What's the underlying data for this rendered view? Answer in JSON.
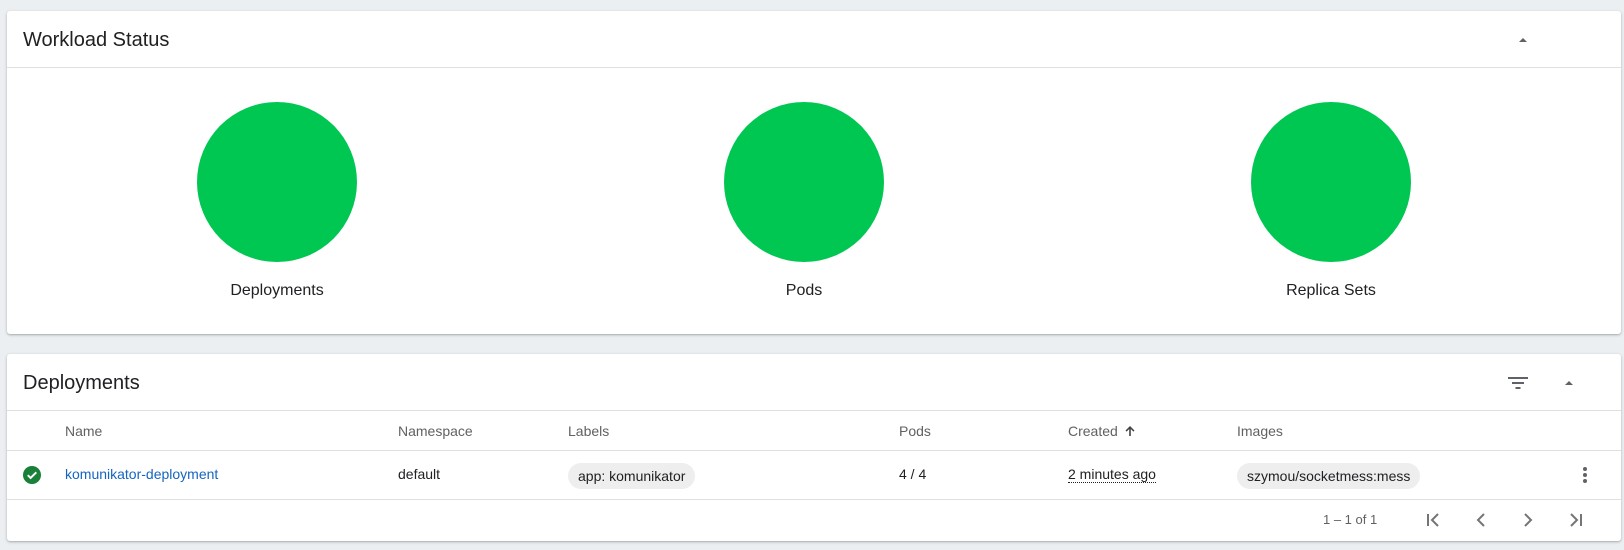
{
  "workload": {
    "title": "Workload Status",
    "items": [
      {
        "label": "Deployments",
        "status_color": "#00c752"
      },
      {
        "label": "Pods",
        "status_color": "#00c752"
      },
      {
        "label": "Replica Sets",
        "status_color": "#00c752"
      }
    ],
    "collapse_icon": "arrow-drop-up-icon"
  },
  "deployments": {
    "title": "Deployments",
    "filter_icon": "filter-list-icon",
    "collapse_icon": "arrow-drop-up-icon",
    "columns": {
      "name": "Name",
      "namespace": "Namespace",
      "labels": "Labels",
      "pods": "Pods",
      "created": "Created",
      "images": "Images"
    },
    "sort_icon": "arrow-upward-icon",
    "rows": [
      {
        "status_icon": "check-circle-icon",
        "status_color": "#188038",
        "name": "komunikator-deployment",
        "namespace": "default",
        "label": "app: komunikator",
        "pods": "4 / 4",
        "created": "2 minutes ago",
        "image": "szymou/socketmess:mess",
        "menu_icon": "more-vert-icon"
      }
    ],
    "paginator": {
      "range": "1 – 1 of 1",
      "first_icon": "first-page-icon",
      "prev_icon": "chevron-left-icon",
      "next_icon": "chevron-right-icon",
      "last_icon": "last-page-icon"
    }
  }
}
